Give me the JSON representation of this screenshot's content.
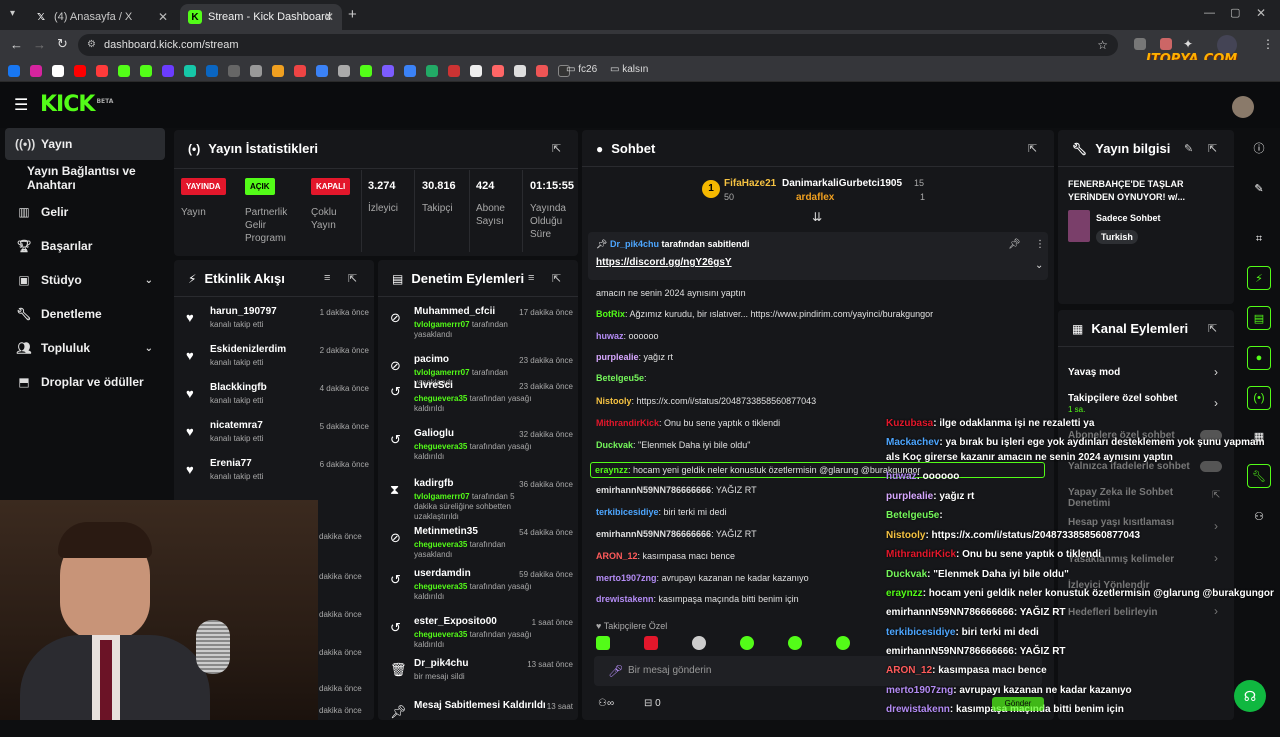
{
  "browser": {
    "tabs": [
      {
        "title": "(4) Anasayfa / X",
        "icon": "x-logo-icon"
      },
      {
        "title": "Stream - Kick Dashboard",
        "icon": "kick-logo-icon"
      }
    ],
    "new_tab": "+",
    "url": "dashboard.kick.com/stream",
    "bookmarks": [
      "fc26",
      "kalsın"
    ],
    "watermark": "ITOPYA.COM"
  },
  "kick": {
    "logo": "KICK",
    "logo_tag": "BETA"
  },
  "nav": {
    "items": [
      {
        "label": "Yayın",
        "icon": "broadcast-icon"
      },
      {
        "label": "Yayın Bağlantısı ve Anahtarı",
        "icon": ""
      },
      {
        "label": "Gelir",
        "icon": "revenue-icon"
      },
      {
        "label": "Başarılar",
        "icon": "trophy-icon"
      },
      {
        "label": "Stüdyo",
        "icon": "studio-icon"
      },
      {
        "label": "Denetleme",
        "icon": "wrench-icon"
      },
      {
        "label": "Topluluk",
        "icon": "community-icon"
      },
      {
        "label": "Droplar ve ödüller",
        "icon": "drops-icon"
      }
    ]
  },
  "stats": {
    "title": "Yayın İstatistikleri",
    "status": [
      {
        "badge": "YAYINDA",
        "label": "Yayın",
        "color": "#e3172b"
      },
      {
        "badge": "AÇIK",
        "label": "Partnerlik Gelir Programı",
        "color": "#53fc18"
      },
      {
        "badge": "KAPALI",
        "label": "Çoklu Yayın",
        "color": "#e3172b"
      }
    ],
    "values": [
      {
        "value": "3.274",
        "label": "İzleyici"
      },
      {
        "value": "30.816",
        "label": "Takipçi"
      },
      {
        "value": "424",
        "label": "Abone Sayısı"
      },
      {
        "value": "01:15:55",
        "label": "Yayında Olduğu Süre"
      }
    ]
  },
  "activity": {
    "title": "Etkinlik Akışı",
    "rows": [
      {
        "name": "harun_190797",
        "sub": "kanalı takip etti",
        "time": "1 dakika önce"
      },
      {
        "name": "Eskidenizlerdim",
        "sub": "kanalı takip etti",
        "time": "2 dakika önce"
      },
      {
        "name": "Blackkingfb",
        "sub": "kanalı takip etti",
        "time": "4 dakika önce"
      },
      {
        "name": "nicatemra7",
        "sub": "kanalı takip etti",
        "time": "5 dakika önce"
      },
      {
        "name": "Erenia77",
        "sub": "kanalı takip etti",
        "time": "6 dakika önce"
      }
    ],
    "extra_times": [
      "dakika önce",
      "dakika önce",
      "dakika önce",
      "dakika önce",
      "dakika önce",
      "dakika önce"
    ]
  },
  "moderation": {
    "title": "Denetim Eylemleri",
    "rows": [
      {
        "name": "Muhammed_cfcii",
        "by": "tvlolgamerrr07",
        "sub": " tarafından yasaklandı",
        "time": "17 dakika önce",
        "icon": "ban-icon"
      },
      {
        "name": "pacimo",
        "by": "tvlolgamerrr07",
        "sub": " tarafından yasaklandı",
        "time": "23 dakika önce",
        "icon": "ban-icon"
      },
      {
        "name": "LivreSci",
        "by": "cheguevera35",
        "sub": " tarafından yasağı kaldırıldı",
        "time": "23 dakika önce",
        "icon": "unban-icon"
      },
      {
        "name": "Galioglu",
        "by": "cheguevera35",
        "sub": " tarafından yasağı kaldırıldı",
        "time": "32 dakika önce",
        "icon": "unban-icon"
      },
      {
        "name": "kadirgfb",
        "by": "tvlolgamerrr07",
        "sub": " tarafından 5 dakika süreliğine sohbetten uzaklaştırıldı",
        "time": "36 dakika önce",
        "icon": "timeout-icon"
      },
      {
        "name": "Metinmetin35",
        "by": "cheguevera35",
        "sub": " tarafından yasaklandı",
        "time": "54 dakika önce",
        "icon": "ban-icon"
      },
      {
        "name": "userdamdin",
        "by": "cheguevera35",
        "sub": " tarafından yasağı kaldırıldı",
        "time": "59 dakika önce",
        "icon": "unban-icon"
      },
      {
        "name": "ester_Exposito00",
        "by": "cheguevera35",
        "sub": " tarafından yasağı kaldırıldı",
        "time": "1 saat önce",
        "icon": "unban-icon"
      },
      {
        "name": "Dr_pik4chu",
        "by": "",
        "sub": "bir mesajı sildi",
        "time": "13 saat önce",
        "icon": "trash-icon"
      },
      {
        "name": "Mesaj Sabitlemesi Kaldırıldı",
        "by": "",
        "sub": "",
        "time": "13 saat",
        "icon": "unpin-icon"
      }
    ]
  },
  "chat": {
    "title": "Sohbet",
    "leaders": [
      {
        "rank": "1",
        "name": "FifaHaze21",
        "count": "50"
      },
      {
        "rank": "",
        "name": "DanimarkaliGurbetci1905",
        "count": "15"
      },
      {
        "rank": "",
        "name": "ardaflex",
        "count": "1"
      }
    ],
    "pinned_by": "Dr_pik4chu",
    "pinned_suffix": " tarafından sabitlendi",
    "pinned_link": "https://discord.gg/ngY26gsY",
    "messages": [
      {
        "user": "",
        "color": "#e0e0e0",
        "text": "amacın ne senin 2024 aynısını yaptın"
      },
      {
        "user": "BotRix",
        "color": "#53fc18",
        "text": ": Ağzımız kurudu, bir ıslatıver... https://www.pindirim.com/yayinci/burakgungor"
      },
      {
        "user": "huwaz",
        "color": "#b48cf5",
        "text": ": oooooo"
      },
      {
        "user": "purplealie",
        "color": "#d7a8ff",
        "text": ": yağız rt"
      },
      {
        "user": "Betelgeu5e",
        "color": "#75f65b",
        "text": ":"
      },
      {
        "user": "Nistooly",
        "color": "#f5c242",
        "text": ": https://x.com/i/status/2048733858560877043"
      },
      {
        "user": "MithrandirKick",
        "color": "#e3172b",
        "text": ": Onu bu sene yaptık o tiklendi"
      },
      {
        "user": "Duckvak",
        "color": "#75f65b",
        "text": ": \"Elenmek Daha iyi bile oldu\""
      },
      {
        "user": "eraynzz",
        "color": "#53fc18",
        "text": ": hocam yeni geldik neler konustuk özetlermisin @glarung @burakgungor"
      },
      {
        "user": "emirhannN59NN786666666",
        "color": "#e0e0e0",
        "text": ": YAĞIZ RT"
      },
      {
        "user": "terkibicesidiye",
        "color": "#4da6ff",
        "text": ": biri terki mi dedi"
      },
      {
        "user": "emirhannN59NN786666666",
        "color": "#e0e0e0",
        "text": ": YAĞIZ RT"
      },
      {
        "user": "ARON_12",
        "color": "#ff5b5b",
        "text": ": kasımpasa macı bence"
      },
      {
        "user": "merto1907zng",
        "color": "#b48cf5",
        "text": ": avrupayı kazanan ne kadar kazanıyo"
      },
      {
        "user": "drewistakenn",
        "color": "#b48cf5",
        "text": ": kasımpaşa maçında bitti benim için"
      }
    ],
    "followers_only": "Takipçilere Özel",
    "input_placeholder": "Bir mesaj gönderin",
    "footer_count": "0"
  },
  "overlay": {
    "lines": [
      {
        "user": "Kuzubasa",
        "color": "#e3172b",
        "text": ": ilge odaklanma işi ne rezaletti ya"
      },
      {
        "user": "Mackachev",
        "color": "#4da6ff",
        "text": ": ya bırak bu işleri ege yok aydınları desteklemem yok şunu yapmam"
      },
      {
        "user": "",
        "color": "#fff",
        "text": "als Koç girerse kazanır amacın ne senin 2024 aynısını yaptın"
      },
      {
        "user": "huwaz",
        "color": "#b48cf5",
        "text": ": oooooo"
      },
      {
        "user": "purplealie",
        "color": "#d7a8ff",
        "text": ": yağız rt"
      },
      {
        "user": "Betelgeu5e",
        "color": "#75f65b",
        "text": ":"
      },
      {
        "user": "Nistooly",
        "color": "#f5c242",
        "text": ": https://x.com/i/status/2048733858560877043"
      },
      {
        "user": "MithrandirKick",
        "color": "#e3172b",
        "text": ": Onu bu sene yaptık o tiklendi"
      },
      {
        "user": "Duckvak",
        "color": "#75f65b",
        "text": ": \"Elenmek Daha iyi bile oldu\""
      },
      {
        "user": "eraynzz",
        "color": "#53fc18",
        "text": ": hocam yeni geldik neler konustuk özetlermisin @glarung @burakgungor"
      },
      {
        "user": "emirhannN59NN786666666",
        "color": "#fff",
        "text": ": YAĞIZ RT"
      },
      {
        "user": "terkibicesidiye",
        "color": "#4da6ff",
        "text": ": biri terki mi dedi"
      },
      {
        "user": "emirhannN59NN786666666",
        "color": "#fff",
        "text": ": YAĞIZ RT"
      },
      {
        "user": "ARON_12",
        "color": "#ff5b5b",
        "text": ": kasımpasa macı bence"
      },
      {
        "user": "merto1907zng",
        "color": "#b48cf5",
        "text": ": avrupayı kazanan ne kadar kazanıyo"
      },
      {
        "user": "drewistakenn",
        "color": "#b48cf5",
        "text": ": kasımpaşa maçında bitti benim için"
      }
    ],
    "send_label": "Gönder"
  },
  "stream_info": {
    "title": "Yayın bilgisi",
    "stream_title": "FENERBAHÇE'DE TAŞLAR YERİNDEN OYNUYOR! w/...",
    "category": "Sadece Sohbet",
    "language": "Turkish"
  },
  "channel_actions": {
    "title": "Kanal Eylemleri",
    "items": [
      {
        "label": "Yavaş mod",
        "sub": ""
      },
      {
        "label": "Takipçilere özel sohbet",
        "sub": "1 sa."
      },
      {
        "label": "Abonelere özel sohbet",
        "sub": ""
      },
      {
        "label": "Yalnızca ifadelerle sohbet",
        "sub": ""
      },
      {
        "label": "Yapay Zeka ile Sohbet Denetimi",
        "sub": ""
      },
      {
        "label": "Hesap yaşı kısıtlaması",
        "sub": ""
      },
      {
        "label": "Yasaklanmış kelimeler",
        "sub": ""
      },
      {
        "label": "İzleyici Yönlendir",
        "sub": ""
      },
      {
        "label": "Hedefleri belirleyin",
        "sub": ""
      }
    ]
  }
}
